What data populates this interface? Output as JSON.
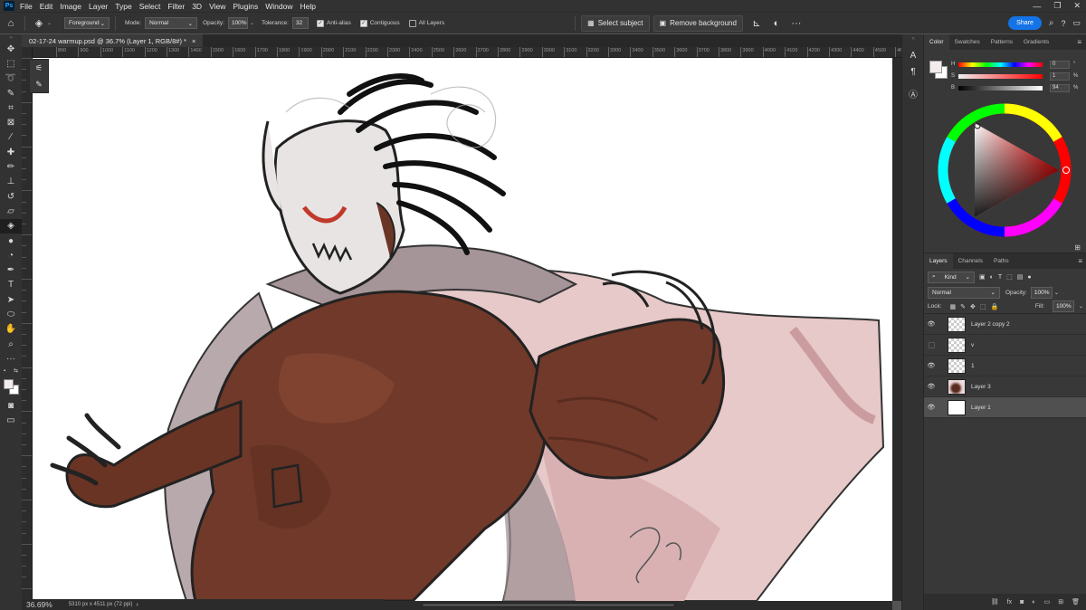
{
  "menu": {
    "logo": "Ps",
    "items": [
      "File",
      "Edit",
      "Image",
      "Layer",
      "Type",
      "Select",
      "Filter",
      "3D",
      "View",
      "Plugins",
      "Window",
      "Help"
    ],
    "window_controls": [
      "—",
      "❐",
      "✕"
    ]
  },
  "options_bar": {
    "fill_source": "Foreground",
    "mode_label": "Mode:",
    "mode_value": "Normal",
    "opacity_label": "Opacity:",
    "opacity_value": "100%",
    "tolerance_label": "Tolerance:",
    "tolerance_value": "32",
    "anti_alias_label": "Anti-alias",
    "anti_alias_checked": true,
    "contiguous_label": "Contiguous",
    "contiguous_checked": true,
    "all_layers_label": "All Layers",
    "all_layers_checked": false,
    "select_subject_label": "Select subject",
    "remove_background_label": "Remove background",
    "more_label": "···",
    "share_label": "Share"
  },
  "document": {
    "tab_title": "02-17-24 warmup.psd @ 36.7% (Layer 1, RGB/8#) *",
    "close_label": "×",
    "zoom": "36.69%",
    "dimensions": "5310 px x 4511 px (72 ppi)"
  },
  "ruler": {
    "h_ticks": [
      "800",
      "900",
      "1000",
      "1100",
      "1200",
      "1300",
      "1400",
      "1500",
      "1600",
      "1700",
      "1800",
      "1900",
      "2000",
      "2100",
      "2200",
      "2300",
      "2400",
      "2500",
      "2600",
      "2700",
      "2800",
      "2900",
      "3000",
      "3100",
      "3200",
      "3300",
      "3400",
      "3500",
      "3600",
      "3700",
      "3800",
      "3900",
      "4000",
      "4100",
      "4200",
      "4300",
      "4400",
      "4500",
      "4600"
    ]
  },
  "color_panel": {
    "tabs": [
      "Color",
      "Swatches",
      "Patterns",
      "Gradients"
    ],
    "active_tab": "Color",
    "fg_color": "#f2ecec",
    "bg_color": "#ffffff",
    "h_label": "H",
    "h_value": "0",
    "h_unit": "°",
    "s_label": "S",
    "s_value": "1",
    "s_unit": "%",
    "b_label": "B",
    "b_value": "94",
    "b_unit": "%"
  },
  "layers_panel": {
    "tabs": [
      "Layers",
      "Channels",
      "Paths"
    ],
    "active_tab": "Layers",
    "filter_kind": "Kind",
    "blend_mode": "Normal",
    "opacity_label": "Opacity:",
    "opacity_value": "100%",
    "lock_label": "Lock:",
    "fill_label": "Fill:",
    "fill_value": "100%",
    "layers": [
      {
        "name": "Layer 2 copy 2",
        "visible": true,
        "thumb": "transparent",
        "selected": false
      },
      {
        "name": "v",
        "visible": false,
        "thumb": "transparent",
        "selected": false
      },
      {
        "name": "1",
        "visible": true,
        "thumb": "transparent",
        "selected": false
      },
      {
        "name": "Layer 3",
        "visible": true,
        "thumb": "art",
        "selected": false
      },
      {
        "name": "Layer 1",
        "visible": true,
        "thumb": "white",
        "selected": true
      }
    ],
    "bottom_icons": [
      "link-icon",
      "fx-icon",
      "mask-icon",
      "adjustment-icon",
      "group-icon",
      "new-layer-icon",
      "trash-icon"
    ]
  }
}
